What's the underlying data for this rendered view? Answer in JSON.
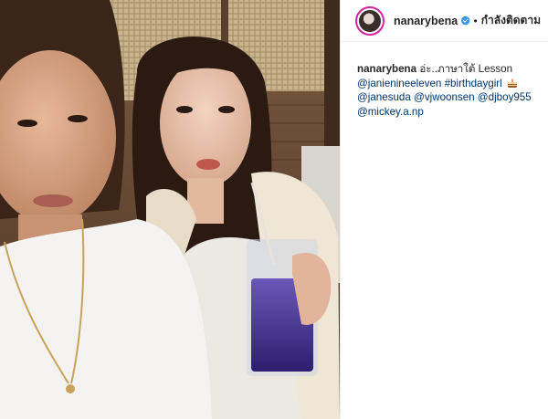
{
  "header": {
    "username": "nanarybena",
    "separator": "•",
    "follow_label": "กำลังติดตาม",
    "verified_icon": "verified-badge-icon"
  },
  "caption": {
    "username": "nanarybena",
    "text": "อ่ะ..ภาษาใต้ Lesson",
    "line1_tags": [
      "@janienineeleven",
      "#birthdaygirl"
    ],
    "emoji": "cake-emoji",
    "line2_tags": [
      "@janesuda",
      "@vjwoonsen",
      "@djboy955"
    ],
    "line3_tags": [
      "@mickey.a.np"
    ]
  },
  "colors": {
    "link": "#003569",
    "text": "#262626",
    "verified": "#3897f0",
    "avatar_ring": "#d6249f"
  }
}
